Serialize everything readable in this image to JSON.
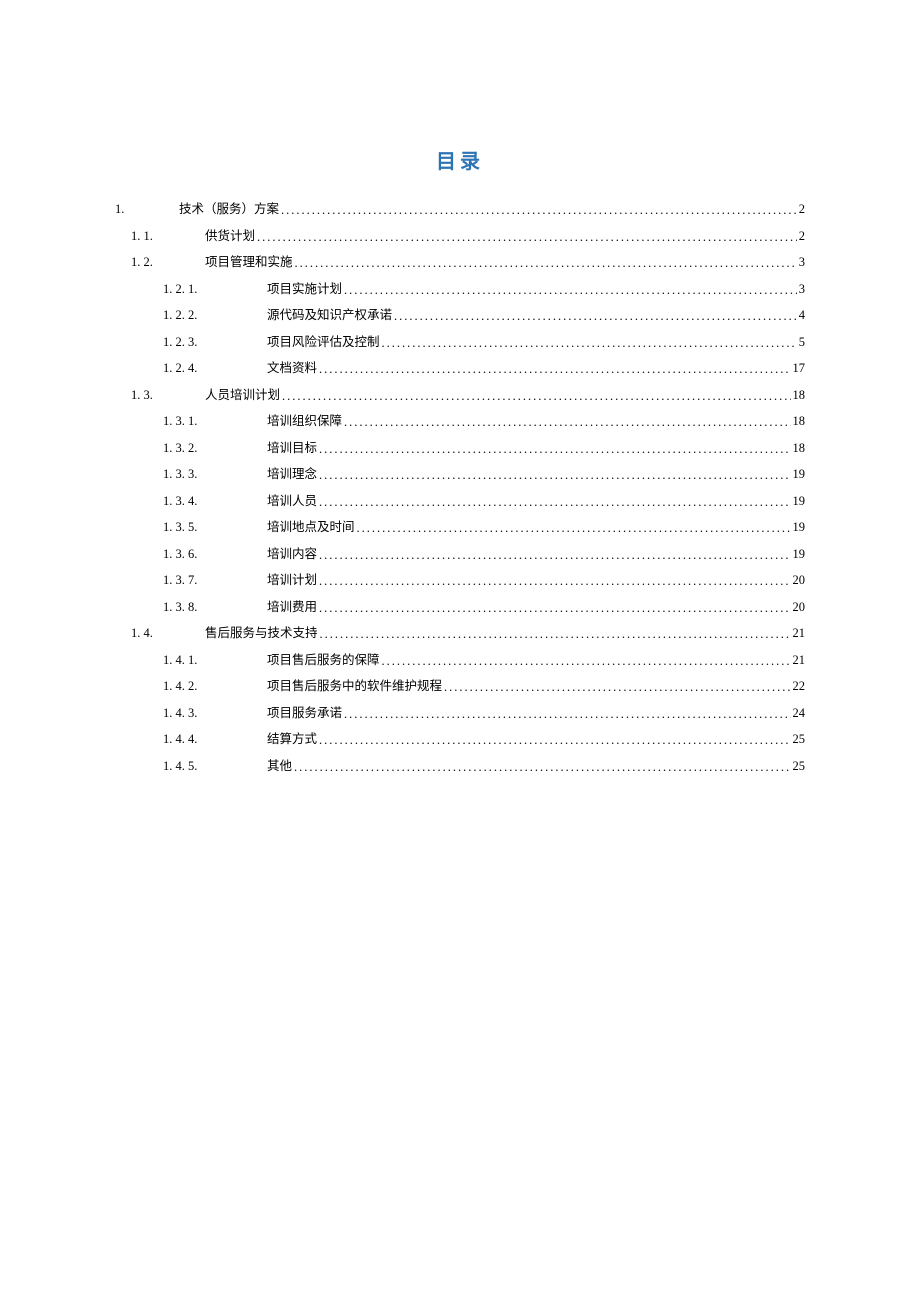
{
  "title": "目录",
  "toc": [
    {
      "level": 1,
      "num": "1.",
      "text": "技术（服务）方案",
      "page": "2"
    },
    {
      "level": 2,
      "num": "1. 1.",
      "text": "供货计划",
      "page": "2"
    },
    {
      "level": 2,
      "num": "1. 2.",
      "text": "项目管理和实施",
      "page": "3"
    },
    {
      "level": 3,
      "num": "1. 2. 1.",
      "text": "项目实施计划",
      "page": "3"
    },
    {
      "level": 3,
      "num": "1. 2. 2.",
      "text": "源代码及知识产权承诺",
      "page": "4"
    },
    {
      "level": 3,
      "num": "1. 2. 3.",
      "text": "项目风险评估及控制",
      "page": "5"
    },
    {
      "level": 3,
      "num": "1. 2. 4.",
      "text": "文档资料",
      "page": "17"
    },
    {
      "level": 2,
      "num": "1. 3.",
      "text": "人员培训计划",
      "page": "18"
    },
    {
      "level": 3,
      "num": "1. 3.  1.",
      "text": "培训组织保障",
      "page": "18"
    },
    {
      "level": 3,
      "num": "1. 3. 2.",
      "text": "培训目标",
      "page": "18"
    },
    {
      "level": 3,
      "num": "1. 3. 3.",
      "text": "培训理念",
      "page": "19"
    },
    {
      "level": 3,
      "num": "1. 3. 4.",
      "text": "培训人员",
      "page": "19"
    },
    {
      "level": 3,
      "num": "1. 3. 5.",
      "text": "培训地点及时间",
      "page": "19"
    },
    {
      "level": 3,
      "num": "1. 3. 6.",
      "text": "培训内容",
      "page": "19"
    },
    {
      "level": 3,
      "num": "1. 3. 7.",
      "text": "培训计划",
      "page": "20"
    },
    {
      "level": 3,
      "num": "1. 3. 8.",
      "text": "培训费用",
      "page": "20"
    },
    {
      "level": 2,
      "num": "1. 4.",
      "text": "售后服务与技术支持",
      "page": "21"
    },
    {
      "level": 3,
      "num": "1. 4.  1.",
      "text": "项目售后服务的保障",
      "page": "21"
    },
    {
      "level": 3,
      "num": "1. 4. 2.",
      "text": "项目售后服务中的软件维护规程",
      "page": "22"
    },
    {
      "level": 3,
      "num": "1. 4. 3.",
      "text": "项目服务承诺",
      "page": "24"
    },
    {
      "level": 3,
      "num": "1. 4. 4.",
      "text": "结算方式",
      "page": "25"
    },
    {
      "level": 3,
      "num": "1. 4. 5.",
      "text": "其他",
      "page": "25"
    }
  ]
}
